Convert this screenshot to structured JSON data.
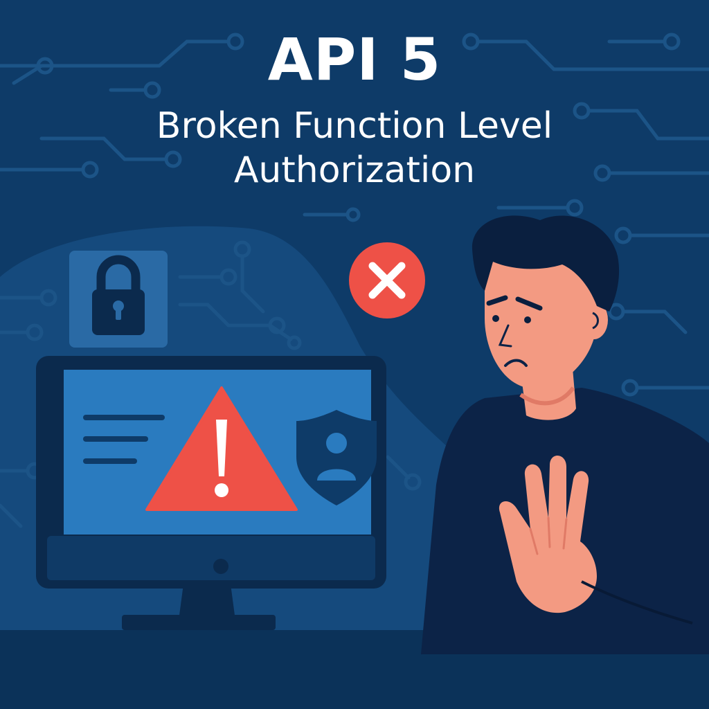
{
  "title": {
    "main": "API 5",
    "subtitle_line1": "Broken Function Level",
    "subtitle_line2": "Authorization"
  },
  "colors": {
    "background": "#0e3b68",
    "background_dark": "#0a2d52",
    "circuit": "#1c5487",
    "monitor_frame": "#0b2a4d",
    "monitor_screen": "#2a7bbf",
    "warning_red": "#ee5147",
    "shirt": "#0c2347",
    "skin": "#f39a82",
    "hair": "#0a1f3f"
  },
  "icons": {
    "lock": "padlock-icon",
    "error": "x-circle-icon",
    "warning": "warning-triangle-icon",
    "shield": "shield-user-icon",
    "stop": "stop-hand-gesture"
  }
}
